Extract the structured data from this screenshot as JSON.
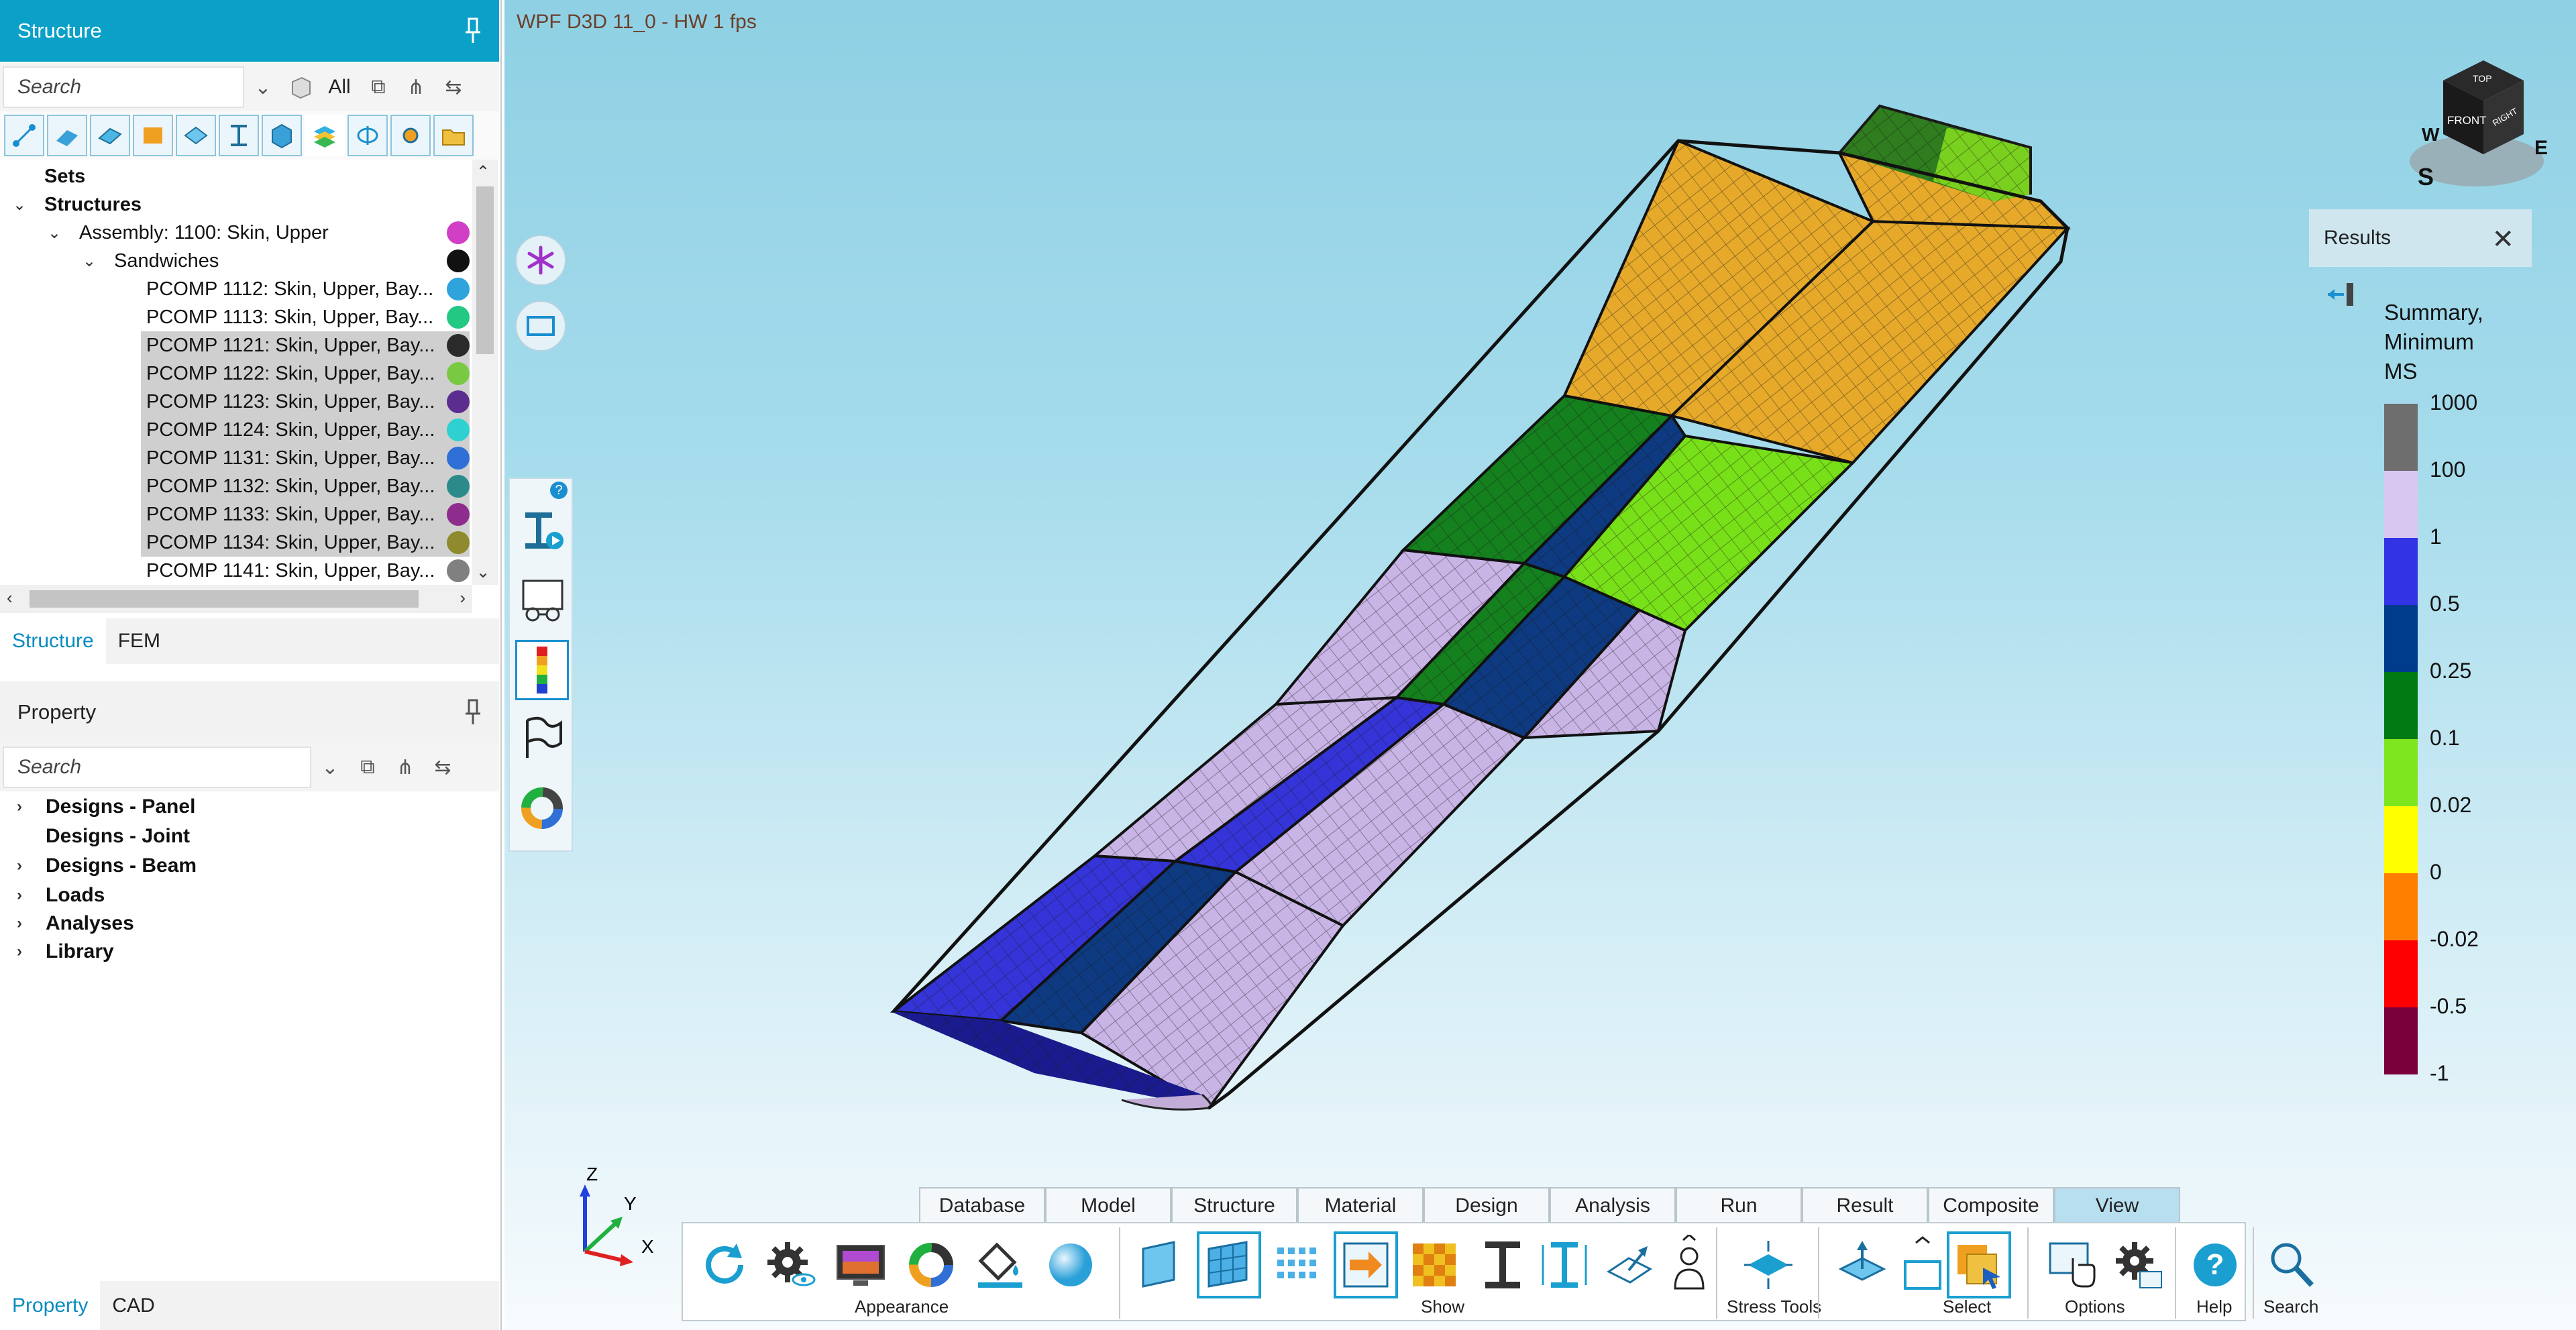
{
  "structure_panel": {
    "title": "Structure",
    "search_placeholder": "Search",
    "filter_all": "All",
    "tree": {
      "sets": "Sets",
      "structures": "Structures",
      "assembly": "Assembly: 1100: Skin, Upper",
      "sandwiches": "Sandwiches",
      "items": [
        {
          "label": "PCOMP 1112: Skin, Upper, Bay...",
          "color": "#2ea3dc",
          "selected": false
        },
        {
          "label": "PCOMP 1113: Skin, Upper, Bay...",
          "color": "#22c983",
          "selected": false
        },
        {
          "label": "PCOMP 1121: Skin, Upper, Bay...",
          "color": "#2a2a2a",
          "selected": true
        },
        {
          "label": "PCOMP 1122: Skin, Upper, Bay...",
          "color": "#7ac943",
          "selected": true
        },
        {
          "label": "PCOMP 1123: Skin, Upper, Bay...",
          "color": "#5b2d8e",
          "selected": true
        },
        {
          "label": "PCOMP 1124: Skin, Upper, Bay...",
          "color": "#2ed0d0",
          "selected": true
        },
        {
          "label": "PCOMP 1131: Skin, Upper, Bay...",
          "color": "#2f6fd6",
          "selected": true
        },
        {
          "label": "PCOMP 1132: Skin, Upper, Bay...",
          "color": "#2b8b8b",
          "selected": true
        },
        {
          "label": "PCOMP 1133: Skin, Upper, Bay...",
          "color": "#8e2d8e",
          "selected": true
        },
        {
          "label": "PCOMP 1134: Skin, Upper, Bay...",
          "color": "#8e8a2d",
          "selected": true
        },
        {
          "label": "PCOMP 1141: Skin, Upper, Bay...",
          "color": "#808080",
          "selected": false
        }
      ],
      "assembly_color": "#d13fc7",
      "sandwiches_color": "#111111"
    },
    "tabs": [
      "Structure",
      "FEM"
    ]
  },
  "property_panel": {
    "title": "Property",
    "search_placeholder": "Search",
    "tree": [
      "Designs - Panel",
      "Designs - Joint",
      "Designs - Beam",
      "Loads",
      "Analyses",
      "Library"
    ],
    "tabs": [
      "Property",
      "CAD"
    ]
  },
  "viewport": {
    "title": "WPF D3D 11_0 - HW  1 fps"
  },
  "results": {
    "header": "Results",
    "title_lines": [
      "Summary,",
      "Minimum",
      "MS"
    ],
    "legend": [
      {
        "label": "1000",
        "color": "#6e6e6e"
      },
      {
        "label": "100",
        "color": "#d8c8f0"
      },
      {
        "label": "1",
        "color": "#3333e6"
      },
      {
        "label": "0.5",
        "color": "#003c8c"
      },
      {
        "label": "0.25",
        "color": "#007a12"
      },
      {
        "label": "0.1",
        "color": "#7ee61e"
      },
      {
        "label": "0.02",
        "color": "#ffff00"
      },
      {
        "label": "0",
        "color": "#ff7f00"
      },
      {
        "label": "-0.02",
        "color": "#ff0000"
      },
      {
        "label": "-0.5",
        "color": "#7a003c"
      }
    ],
    "legend_bottom_label": "-1"
  },
  "view_cube": {
    "top": "TOP",
    "front": "FRONT",
    "side": "RIGHT",
    "s": "S",
    "e": "E",
    "w": "W"
  },
  "axis_triad": {
    "x": "X",
    "y": "Y",
    "z": "Z"
  },
  "ribbon": {
    "tabs": [
      "Database",
      "Model",
      "Structure",
      "Material",
      "Design",
      "Analysis",
      "Run",
      "Result",
      "Composite",
      "View"
    ],
    "active_tab": "View",
    "groups": [
      "Appearance",
      "Show",
      "Stress Tools",
      "Select",
      "Options",
      "Help",
      "Search"
    ]
  },
  "colors": {
    "accent": "#0aa0c8",
    "wing_bay_gold": "#e6a92a",
    "wing_bay_lavender": "#c9b4e6",
    "wing_bay_blue": "#3434d8",
    "wing_bay_navy": "#0d3a80",
    "wing_bay_green": "#14801e",
    "wing_bay_lime": "#78e018"
  }
}
